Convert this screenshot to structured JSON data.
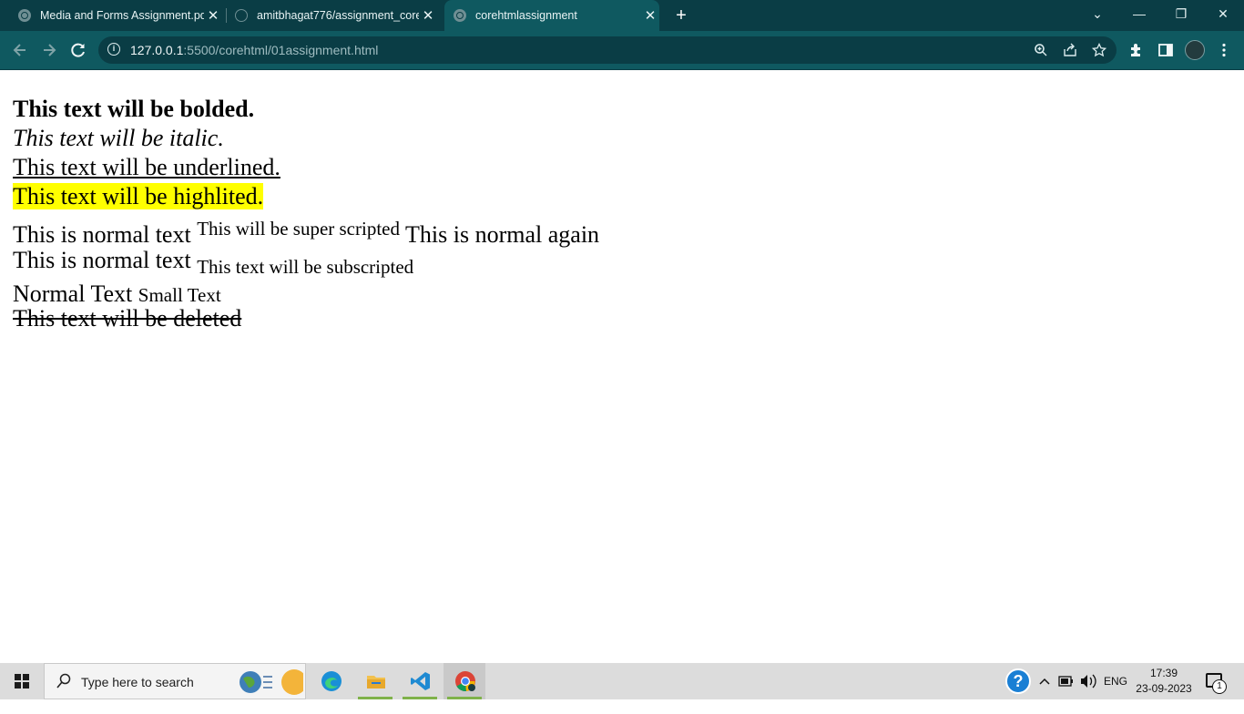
{
  "browser": {
    "tabs": [
      {
        "label": "Media and Forms Assignment.pd",
        "icon": "globe-icon",
        "active": false
      },
      {
        "label": "amitbhagat776/assignment_core",
        "icon": "github-icon",
        "active": false
      },
      {
        "label": "corehtmlassignment",
        "icon": "globe-icon",
        "active": true
      }
    ],
    "new_tab": "+",
    "close_glyph": "✕",
    "window_controls": {
      "tab_search": "⌄",
      "minimize": "—",
      "restore": "❐",
      "close": "✕"
    },
    "url": {
      "host": "127.0.0.1",
      "path": ":5500/corehtml/01assignment.html"
    },
    "toolbar_icons": [
      "back-icon",
      "forward-icon",
      "reload-icon",
      "site-info-icon",
      "zoom-icon",
      "share-icon",
      "bookmark-star-icon",
      "extensions-icon",
      "side-panel-icon",
      "profile-avatar",
      "menu-icon"
    ],
    "colors": {
      "frame": "#0a3d45",
      "toolbar": "#0f5960",
      "omnibox": "#0a3d45"
    }
  },
  "page": {
    "bolded": "This text will be bolded.",
    "italic": "This text will be italic.",
    "underlined": "This text will be underlined.",
    "highlighted": "This text will be highlited.",
    "sup_before": "This is normal text",
    "sup_text": "This will be super scripted",
    "sup_after": "This is normal again",
    "sub_before": "This is normal text",
    "sub_text": "This text will be subscripted",
    "normal_text": "Normal Text",
    "small_text": "Small Text",
    "deleted": "This text will be deleted",
    "highlight_color": "#ffff00"
  },
  "taskbar": {
    "search_placeholder": "Type here to search",
    "apps": [
      "edge-icon",
      "file-explorer-icon",
      "vscode-icon",
      "chrome-icon"
    ],
    "language": "ENG",
    "time": "17:39",
    "date": "23-09-2023",
    "notification_count": "1",
    "help": "?"
  }
}
